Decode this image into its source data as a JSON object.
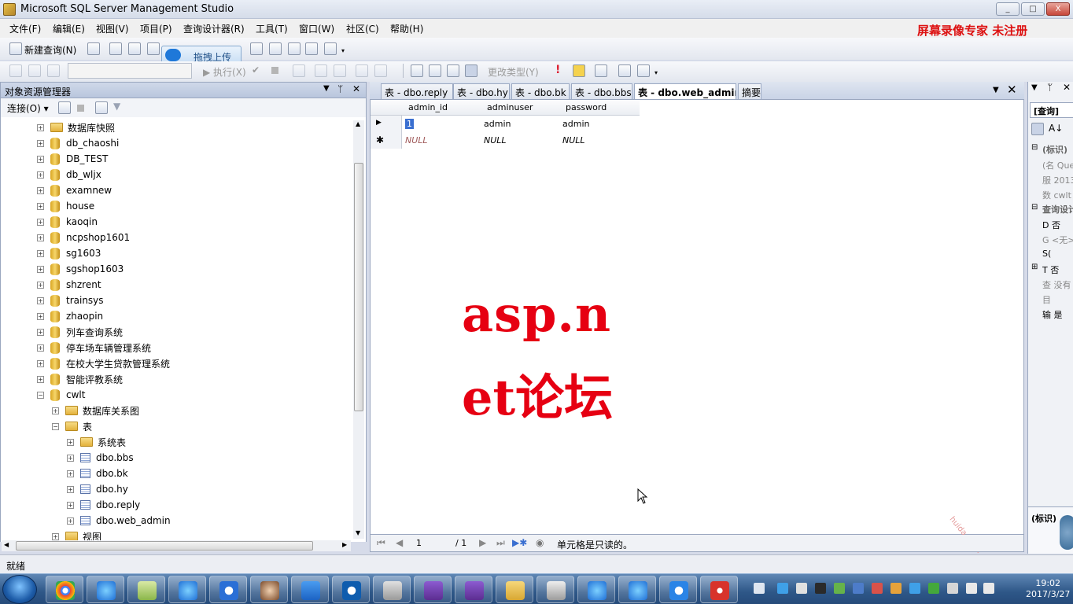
{
  "window": {
    "title": "Microsoft SQL Server Management Studio",
    "min": "_",
    "max": "□",
    "close": "X"
  },
  "menu": [
    "文件(F)",
    "编辑(E)",
    "视图(V)",
    "项目(P)",
    "查询设计器(R)",
    "工具(T)",
    "窗口(W)",
    "社区(C)",
    "帮助(H)"
  ],
  "watermark": "屏幕录像专家  未注册",
  "toolbar": {
    "new_query": "新建查询(N)",
    "execute": "执行(X)",
    "change_type": "更改类型(Y)",
    "baidu_upload": "拖拽上传"
  },
  "object_explorer": {
    "title": "对象资源管理器",
    "pin": "ᛘ",
    "close": "✕",
    "connect": "连接(O)",
    "tree": [
      {
        "label": "数据库快照",
        "icon": "folder-icon",
        "indent": 0,
        "exp": "+"
      },
      {
        "label": "db_chaoshi",
        "icon": "database-icon",
        "indent": 0,
        "exp": "+"
      },
      {
        "label": "DB_TEST",
        "icon": "database-icon",
        "indent": 0,
        "exp": "+"
      },
      {
        "label": "db_wljx",
        "icon": "database-icon",
        "indent": 0,
        "exp": "+"
      },
      {
        "label": "examnew",
        "icon": "database-icon",
        "indent": 0,
        "exp": "+"
      },
      {
        "label": "house",
        "icon": "database-icon",
        "indent": 0,
        "exp": "+"
      },
      {
        "label": "kaoqin",
        "icon": "database-icon",
        "indent": 0,
        "exp": "+"
      },
      {
        "label": "ncpshop1601",
        "icon": "database-icon",
        "indent": 0,
        "exp": "+"
      },
      {
        "label": "sg1603",
        "icon": "database-icon",
        "indent": 0,
        "exp": "+"
      },
      {
        "label": "sgshop1603",
        "icon": "database-icon",
        "indent": 0,
        "exp": "+"
      },
      {
        "label": "shzrent",
        "icon": "database-icon",
        "indent": 0,
        "exp": "+"
      },
      {
        "label": "trainsys",
        "icon": "database-icon",
        "indent": 0,
        "exp": "+"
      },
      {
        "label": "zhaopin",
        "icon": "database-icon",
        "indent": 0,
        "exp": "+"
      },
      {
        "label": "列车查询系统",
        "icon": "database-icon",
        "indent": 0,
        "exp": "+"
      },
      {
        "label": "停车场车辆管理系统",
        "icon": "database-icon",
        "indent": 0,
        "exp": "+"
      },
      {
        "label": "在校大学生贷款管理系统",
        "icon": "database-icon",
        "indent": 0,
        "exp": "+"
      },
      {
        "label": "智能评教系统",
        "icon": "database-icon",
        "indent": 0,
        "exp": "+"
      },
      {
        "label": "cwlt",
        "icon": "database-icon",
        "indent": 0,
        "exp": "−"
      },
      {
        "label": "数据库关系图",
        "icon": "folder-icon",
        "indent": 1,
        "exp": "+"
      },
      {
        "label": "表",
        "icon": "folder-icon",
        "indent": 1,
        "exp": "−"
      },
      {
        "label": "系统表",
        "icon": "folder-icon",
        "indent": 2,
        "exp": "+"
      },
      {
        "label": "dbo.bbs",
        "icon": "table-icon",
        "indent": 2,
        "exp": "+"
      },
      {
        "label": "dbo.bk",
        "icon": "table-icon",
        "indent": 2,
        "exp": "+"
      },
      {
        "label": "dbo.hy",
        "icon": "table-icon",
        "indent": 2,
        "exp": "+"
      },
      {
        "label": "dbo.reply",
        "icon": "table-icon",
        "indent": 2,
        "exp": "+"
      },
      {
        "label": "dbo.web_admin",
        "icon": "table-icon",
        "indent": 2,
        "exp": "+"
      },
      {
        "label": "视图",
        "icon": "folder-icon",
        "indent": 1,
        "exp": "+"
      }
    ]
  },
  "tabs": [
    "表 - dbo.reply",
    "表 - dbo.hy",
    "表 - dbo.bk",
    "表 - dbo.bbs",
    "表 - dbo.web_admin",
    "摘要"
  ],
  "active_tab": 4,
  "grid": {
    "columns": [
      "admin_id",
      "adminuser",
      "password"
    ],
    "rows": [
      [
        "1",
        "admin",
        "admin"
      ],
      [
        "NULL",
        "NULL",
        "NULL"
      ]
    ]
  },
  "overlay": {
    "line1": "asp.n",
    "line2": "et论坛",
    "stamp": "huida_kaifa"
  },
  "navigator": {
    "page": "1",
    "total": "/ 1",
    "status": "单元格是只读的。"
  },
  "properties": {
    "dropdown": "[查询]",
    "section1": "(标识)",
    "rows1": [
      "(名 Que",
      "服 2013",
      "数 cwlt"
    ],
    "section2": "查询设计",
    "rows2": [
      "D 否",
      "G <无>",
      "S(",
      "T 否",
      "查 没有",
      "目",
      "输 是"
    ],
    "footer": "(标识)"
  },
  "status": "就绪",
  "clock": {
    "time": "19:02",
    "date": "2017/3/27"
  },
  "taskbar_apps": [
    "chrome-icon",
    "ie-icon",
    "notepad-icon",
    "ie-icon",
    "sogou-icon",
    "avatar-app-icon",
    "wps-icon",
    "teamviewer-icon",
    "tools-icon",
    "visual-studio-icon",
    "visual-studio-icon",
    "explorer-icon",
    "drive-icon",
    "ie-icon",
    "ie-icon",
    "baidu-netdisk-icon",
    "screen-recorder-icon"
  ]
}
